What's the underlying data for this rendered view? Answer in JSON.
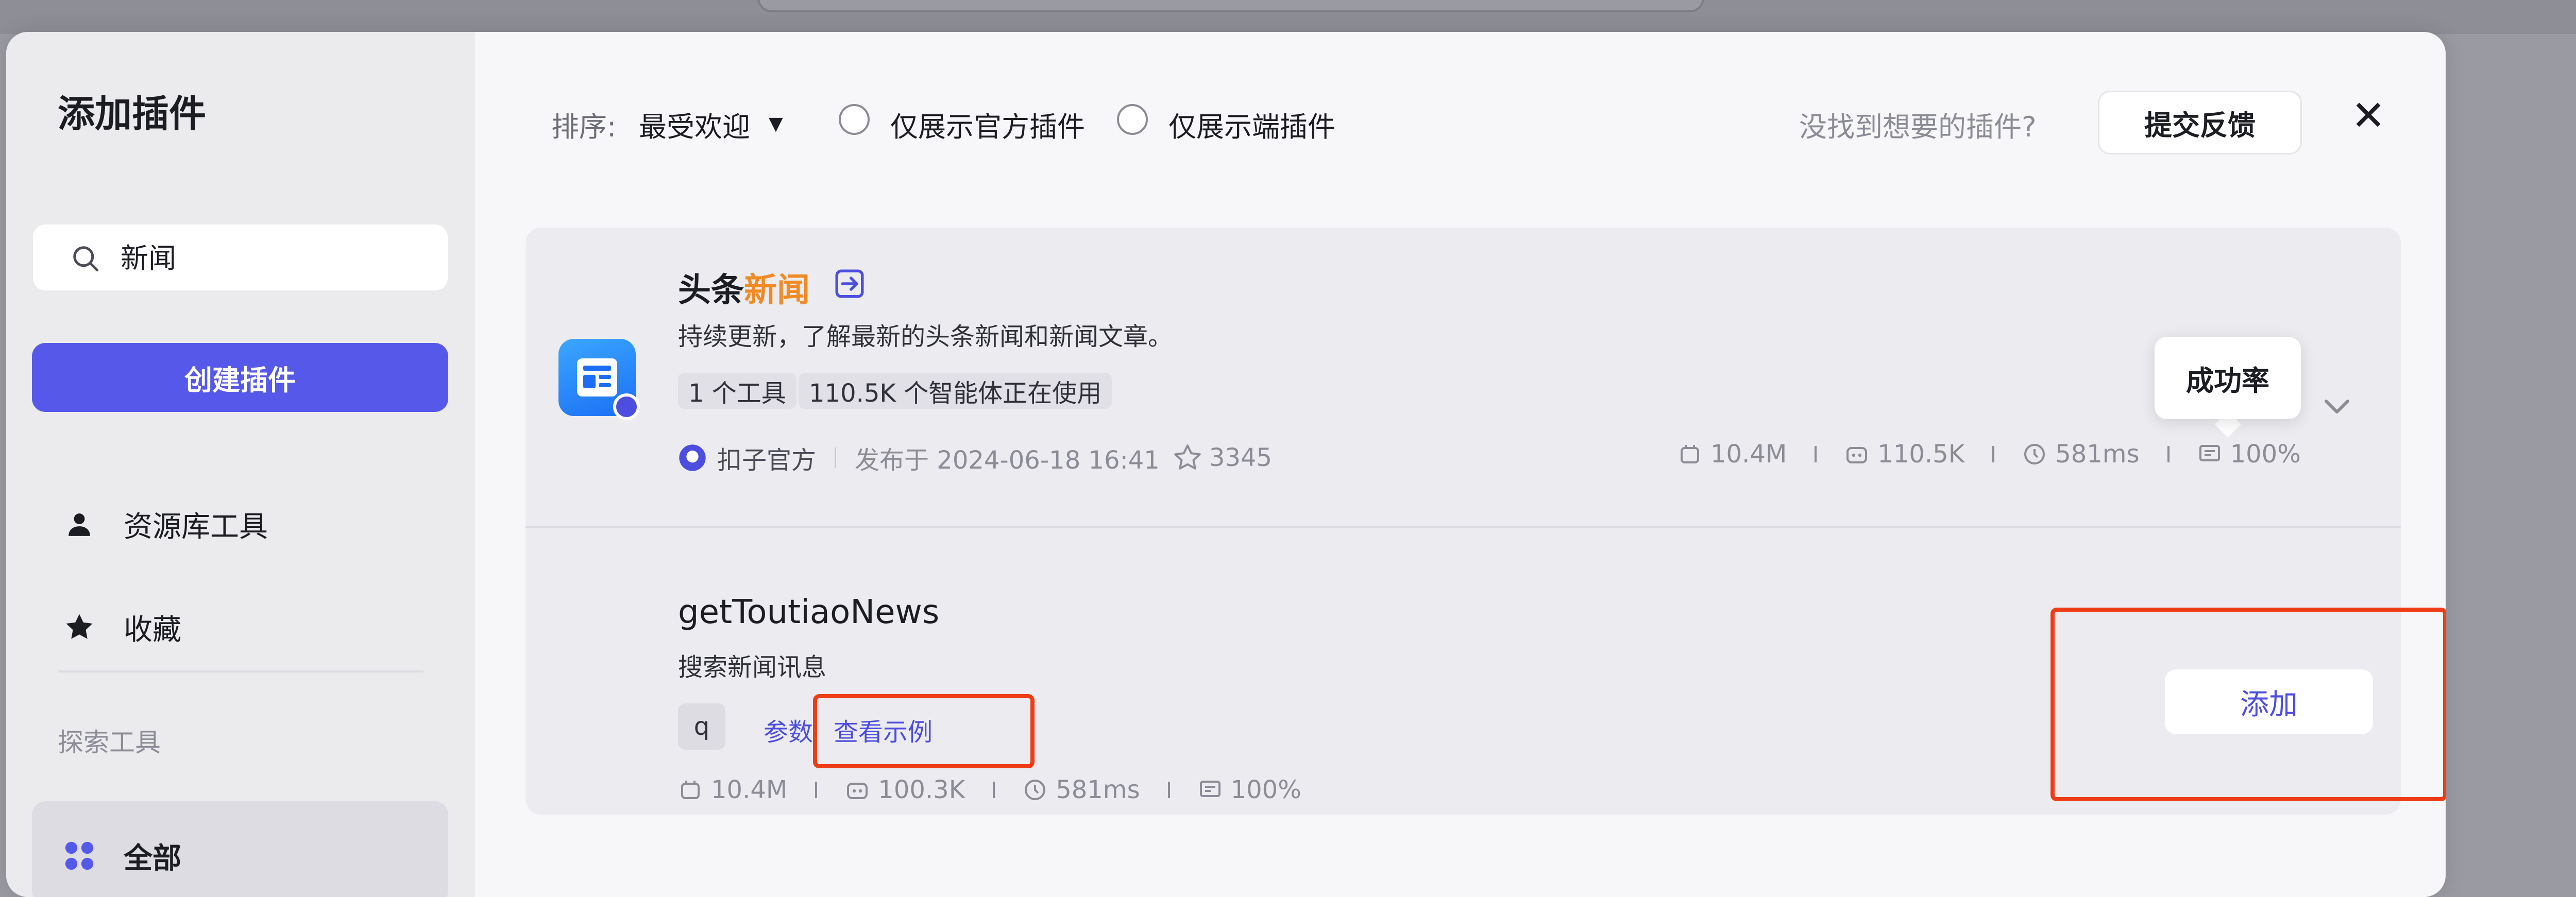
{
  "modal": {
    "title": "添加插件",
    "close_icon": "close-icon"
  },
  "sidebar": {
    "search": {
      "value": "新闻",
      "placeholder": ""
    },
    "create_button": "创建插件",
    "items": [
      {
        "label": "资源库工具",
        "icon": "person-icon"
      },
      {
        "label": "收藏",
        "icon": "star-icon"
      }
    ],
    "section_label": "探索工具",
    "all_item": {
      "label": "全部",
      "icon": "grid-icon"
    }
  },
  "toolbar": {
    "sort_label": "排序:",
    "sort_value": "最受欢迎",
    "filter_official": "仅展示官方插件",
    "filter_device": "仅展示端插件",
    "hint": "没找到想要的插件?",
    "feedback_button": "提交反馈"
  },
  "plugin": {
    "title_prefix": "头条",
    "title_highlight": "新闻",
    "description": "持续更新，了解最新的头条新闻和新闻文章。",
    "tags": [
      "1 个工具",
      "110.5K 个智能体正在使用"
    ],
    "author": "扣子官方",
    "published": "发布于 2024-06-18 16:41",
    "favorites": "3345",
    "stats": [
      "10.4M",
      "110.5K",
      "581ms",
      "100%"
    ],
    "tooltip": "成功率"
  },
  "tool": {
    "name": "getToutiaoNews",
    "description": "搜索新闻讯息",
    "param": "q",
    "param_label": "参数",
    "example_link": "查看示例",
    "stats": [
      "10.4M",
      "100.3K",
      "581ms",
      "100%"
    ],
    "add_button": "添加"
  },
  "colors": {
    "accent": "#5558e8",
    "highlight": "#f08a24",
    "annotation": "#ee3d16"
  }
}
